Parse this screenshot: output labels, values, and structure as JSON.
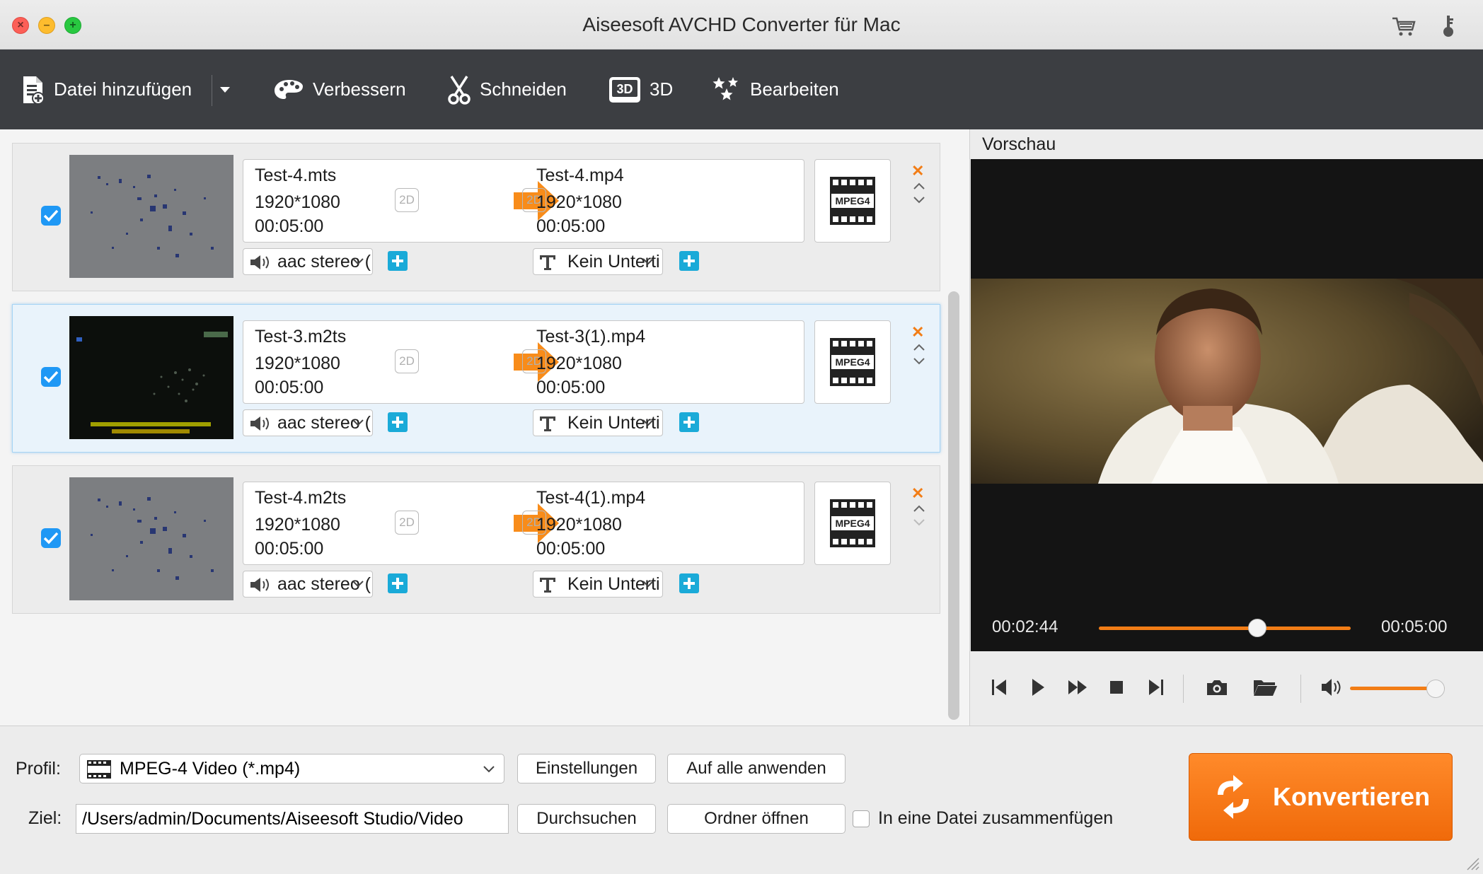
{
  "window": {
    "title": "Aiseesoft AVCHD Converter für Mac"
  },
  "toolbar": {
    "add_file": "Datei hinzufügen",
    "enhance": "Verbessern",
    "cut": "Schneiden",
    "three_d": "3D",
    "edit": "Bearbeiten"
  },
  "files": [
    {
      "source_name": "Test-4.mts",
      "source_res": "1920*1080",
      "source_dur": "00:05:00",
      "output_name": "Test-4.mp4",
      "output_res": "1920*1080",
      "output_dur": "00:05:00",
      "audio": "aac stereo (",
      "subtitle": "Kein Unterti",
      "badge_in": "2D",
      "badge_out": "2D",
      "format_icon": "MPEG4"
    },
    {
      "source_name": "Test-3.m2ts",
      "source_res": "1920*1080",
      "source_dur": "00:05:00",
      "output_name": "Test-3(1).mp4",
      "output_res": "1920*1080",
      "output_dur": "00:05:00",
      "audio": "aac stereo (",
      "subtitle": "Kein Unterti",
      "badge_in": "2D",
      "badge_out": "2D",
      "format_icon": "MPEG4"
    },
    {
      "source_name": "Test-4.m2ts",
      "source_res": "1920*1080",
      "source_dur": "00:05:00",
      "output_name": "Test-4(1).mp4",
      "output_res": "1920*1080",
      "output_dur": "00:05:00",
      "audio": "aac stereo (",
      "subtitle": "Kein Unterti",
      "badge_in": "2D",
      "badge_out": "2D",
      "format_icon": "MPEG4"
    }
  ],
  "preview": {
    "label": "Vorschau",
    "time_current": "00:02:44",
    "time_total": "00:05:00",
    "seek_fraction": 0.63,
    "volume_fraction": 0.9
  },
  "bottom": {
    "profile_label": "Profil:",
    "profile_value": "MPEG-4 Video (*.mp4)",
    "settings_button": "Einstellungen",
    "apply_all_button": "Auf alle anwenden",
    "dest_label": "Ziel:",
    "dest_value": "/Users/admin/Documents/Aiseesoft Studio/Video",
    "browse_button": "Durchsuchen",
    "open_folder_button": "Ordner öffnen",
    "merge_label": "In eine Datei zusammenfügen",
    "convert_button": "Konvertieren"
  },
  "colors": {
    "accent": "#f27d16",
    "toolbar_bg": "#3c3e42",
    "checkbox_blue": "#1f98f5",
    "plus_blue": "#1aaad8"
  }
}
